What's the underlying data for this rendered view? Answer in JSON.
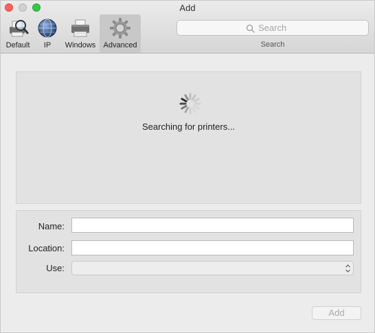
{
  "window": {
    "title": "Add"
  },
  "toolbar": {
    "items": [
      {
        "label": "Default",
        "icon": "default-printer-icon",
        "selected": false
      },
      {
        "label": "IP",
        "icon": "ip-globe-icon",
        "selected": false
      },
      {
        "label": "Windows",
        "icon": "windows-printer-icon",
        "selected": false
      },
      {
        "label": "Advanced",
        "icon": "advanced-gear-icon",
        "selected": true
      }
    ],
    "search": {
      "placeholder": "Search",
      "caption": "Search"
    }
  },
  "list": {
    "status": "Searching for printers..."
  },
  "form": {
    "name": {
      "label": "Name:",
      "value": ""
    },
    "location": {
      "label": "Location:",
      "value": ""
    },
    "use": {
      "label": "Use:",
      "value": ""
    }
  },
  "actions": {
    "add_label": "Add",
    "add_enabled": false
  },
  "colors": {
    "close": "#fc605c",
    "minimize": "#d0d0d0",
    "maximize": "#34c84a",
    "window_bg": "#ececec",
    "panel_bg": "#e2e2e2"
  }
}
